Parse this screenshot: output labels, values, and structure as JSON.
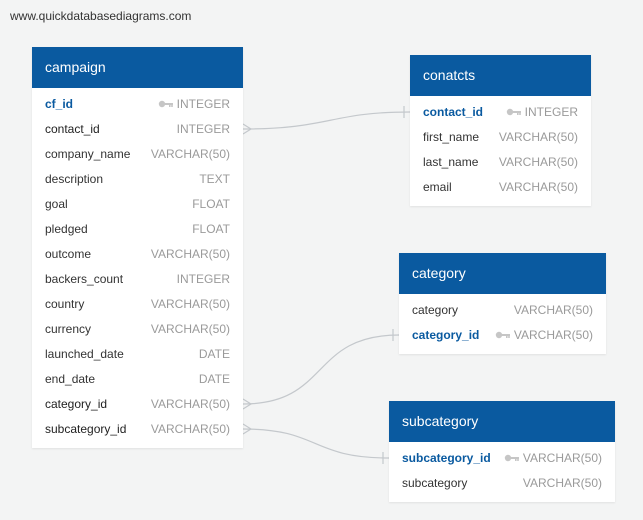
{
  "watermark": "www.quickdatabasediagrams.com",
  "tables": {
    "campaign": {
      "title": "campaign",
      "fields": [
        {
          "name": "cf_id",
          "type": "INTEGER",
          "pk": true
        },
        {
          "name": "contact_id",
          "type": "INTEGER",
          "fk": true
        },
        {
          "name": "company_name",
          "type": "VARCHAR(50)"
        },
        {
          "name": "description",
          "type": "TEXT"
        },
        {
          "name": "goal",
          "type": "FLOAT"
        },
        {
          "name": "pledged",
          "type": "FLOAT"
        },
        {
          "name": "outcome",
          "type": "VARCHAR(50)"
        },
        {
          "name": "backers_count",
          "type": "INTEGER"
        },
        {
          "name": "country",
          "type": "VARCHAR(50)"
        },
        {
          "name": "currency",
          "type": "VARCHAR(50)"
        },
        {
          "name": "launched_date",
          "type": "DATE"
        },
        {
          "name": "end_date",
          "type": "DATE"
        },
        {
          "name": "category_id",
          "type": "VARCHAR(50)",
          "fk": true
        },
        {
          "name": "subcategory_id",
          "type": "VARCHAR(50)",
          "fk": true
        }
      ]
    },
    "conatcts": {
      "title": "conatcts",
      "fields": [
        {
          "name": "contact_id",
          "type": "INTEGER",
          "pk": true
        },
        {
          "name": "first_name",
          "type": "VARCHAR(50)"
        },
        {
          "name": "last_name",
          "type": "VARCHAR(50)"
        },
        {
          "name": "email",
          "type": "VARCHAR(50)"
        }
      ]
    },
    "category": {
      "title": "category",
      "fields": [
        {
          "name": "category",
          "type": "VARCHAR(50)"
        },
        {
          "name": "category_id",
          "type": "VARCHAR(50)",
          "pk": true
        }
      ]
    },
    "subcategory": {
      "title": "subcategory",
      "fields": [
        {
          "name": "subcategory_id",
          "type": "VARCHAR(50)",
          "pk": true
        },
        {
          "name": "subcategory",
          "type": "VARCHAR(50)"
        }
      ]
    }
  },
  "colors": {
    "header": "#0a5aa0",
    "background": "#f3f4f4",
    "link": "#c4c8cc"
  }
}
